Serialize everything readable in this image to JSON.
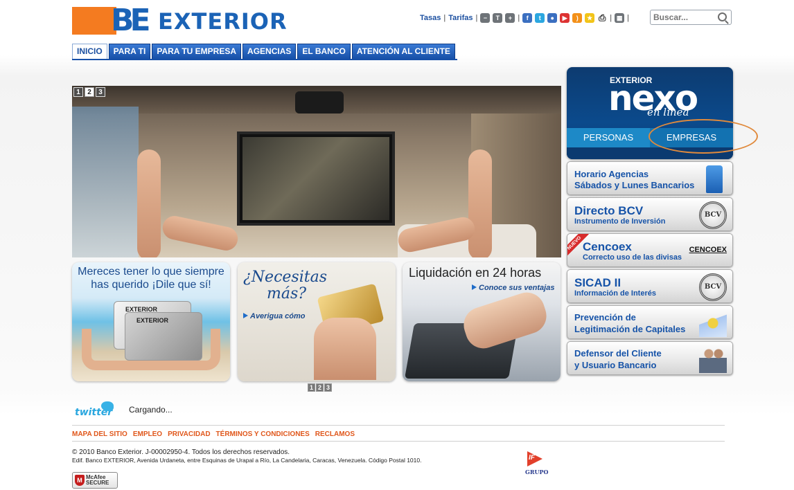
{
  "header": {
    "logo_text": "EXTERIOR",
    "links": [
      "Tasas",
      "Tarifas"
    ],
    "search_placeholder": "Buscar..."
  },
  "nav": {
    "tabs": [
      "INICIO",
      "PARA TI",
      "PARA TU EMPRESA",
      "AGENCIAS",
      "EL BANCO",
      "ATENCIÓN AL CLIENTE"
    ],
    "active": "INICIO"
  },
  "hero": {
    "pager": [
      "1",
      "2",
      "3"
    ],
    "active_page": "2"
  },
  "promos": {
    "card1": {
      "headline_1": "Mereces tener lo que siempre",
      "headline_2": "has querido ¡Dile que sí!",
      "card_label": "EXTERIOR"
    },
    "card2": {
      "headline_1": "¿Necesitas",
      "headline_2": "más?",
      "sub": "Averigua cómo"
    },
    "card3": {
      "headline": "Liquidación en 24 horas",
      "sub": "Conoce sus ventajas"
    },
    "pager": [
      "1",
      "2",
      "3"
    ]
  },
  "nexo": {
    "brand": "EXTERIOR",
    "logo": "nexo",
    "tagline": "en línea",
    "personas": "PERSONAS",
    "empresas": "EMPRESAS"
  },
  "sidebar": [
    {
      "line1": "Horario Agencias",
      "line2": "Sábados y Lunes Bancarios",
      "icon": "chair-icon"
    },
    {
      "line1": "Directo BCV",
      "line2": "Instrumento de Inversión",
      "icon": "bcv-seal-icon",
      "icon_text": "BCV"
    },
    {
      "line1": "Cencoex",
      "line2": "Correcto uso de las divisas",
      "icon": "cencoex-logo",
      "icon_text": "CENCOEX",
      "badge": "NUEVO"
    },
    {
      "line1": "SICAD II",
      "line2": "Información de Interés",
      "icon": "bcv-seal-icon",
      "icon_text": "BCV"
    },
    {
      "line1": "Prevención de",
      "line2": "Legitimación de Capitales",
      "icon": "medal-icon"
    },
    {
      "line1": "Defensor del Cliente",
      "line2": "y Usuario Bancario",
      "icon": "people-icon"
    }
  ],
  "twitter": {
    "logo": "twitter",
    "status": "Cargando..."
  },
  "footer": {
    "links": [
      "MAPA DEL SITIO",
      "EMPLEO",
      "PRIVACIDAD",
      "TÉRMINOS Y CONDICIONES",
      "RECLAMOS"
    ],
    "copyright": "© 2010 Banco Exterior. J-00002950-4. Todos los derechos reservados.",
    "address": "Edif. Banco EXTERIOR, Avenida Urdaneta, entre Esquinas de Urapal a Río, La Candelaria, Caracas, Venezuela. Código Postal 1010.",
    "grupo": {
      "mark": "IF",
      "label": "GRUPO"
    },
    "mcafee": {
      "line1": "McAfee",
      "line2": "SECURE"
    }
  },
  "colors": {
    "brand_blue": "#1b63b6",
    "brand_orange": "#f47b20",
    "footer_link": "#e0571b",
    "highlight": "#e08a3c"
  }
}
